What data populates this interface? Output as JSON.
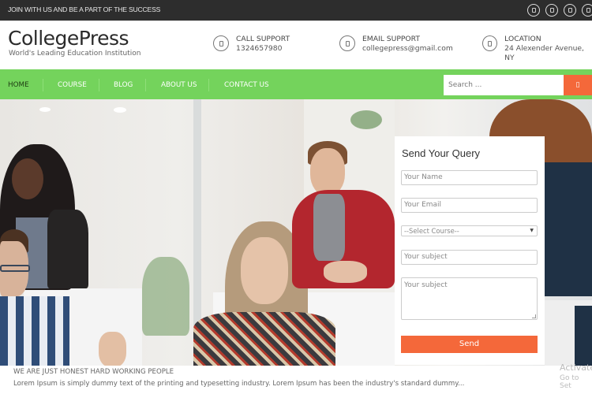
{
  "topbar": {
    "text": "JOIN WITH US AND BE A PART OF THE SUCCESS",
    "social_icons": [
      "facebook-icon",
      "twitter-icon",
      "google-plus-icon",
      "linkedin-icon"
    ]
  },
  "header": {
    "logo": "CollegePress",
    "tagline": "World's Leading Education Institution",
    "contacts": [
      {
        "icon": "phone-icon",
        "title": "CALL SUPPORT",
        "value": "1324657980"
      },
      {
        "icon": "email-icon",
        "title": "EMAIL SUPPORT",
        "value": "collegepress@gmail.com"
      },
      {
        "icon": "location-icon",
        "title": "LOCATION",
        "value": "24 Alexender Avenue, NY"
      }
    ]
  },
  "nav": {
    "items": [
      {
        "label": "HOME",
        "active": true
      },
      {
        "label": "COURSE",
        "active": false
      },
      {
        "label": "BLOG",
        "active": false
      },
      {
        "label": "ABOUT US",
        "active": false
      },
      {
        "label": "CONTACT US",
        "active": false
      }
    ],
    "search_placeholder": "Search ...",
    "search_button_icon": "search-icon"
  },
  "form": {
    "title": "Send Your Query",
    "name_placeholder": "Your Name",
    "email_placeholder": "Your Email",
    "course_selected": "--Select Course--",
    "subject_placeholder": "Your subject",
    "message_placeholder": "Your subject",
    "send_label": "Send"
  },
  "intro": {
    "heading": "WE ARE JUST HONEST HARD WORKING PEOPLE",
    "text": "Lorem Ipsum is simply dummy text of the printing and typesetting industry. Lorem Ipsum has been the industry's standard dummy..."
  },
  "watermark": {
    "line1": "Activate",
    "line2": "Go to Set"
  },
  "colors": {
    "topbar": "#2d2d2d",
    "nav_green": "#74d35c",
    "accent_orange": "#f4683a"
  }
}
